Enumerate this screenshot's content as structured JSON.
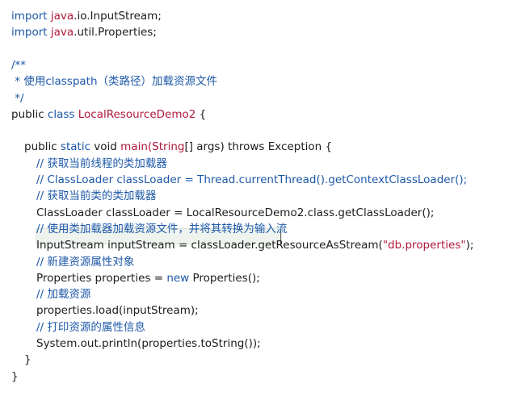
{
  "code": {
    "lines": [
      {
        "indent": 0,
        "segments": [
          {
            "t": "import ",
            "c": "blue"
          },
          {
            "t": "java",
            "c": "red"
          },
          {
            "t": ".io.InputStream;",
            "c": "dark"
          }
        ]
      },
      {
        "indent": 0,
        "segments": [
          {
            "t": "import ",
            "c": "blue"
          },
          {
            "t": "java",
            "c": "red"
          },
          {
            "t": ".util.Properties;",
            "c": "dark"
          }
        ]
      },
      {
        "indent": 0,
        "segments": [
          {
            "t": "",
            "c": "dark"
          }
        ]
      },
      {
        "indent": 0,
        "segments": [
          {
            "t": "/**",
            "c": "cm"
          }
        ]
      },
      {
        "indent": 0,
        "segments": [
          {
            "t": " * 使用classpath（类路径）加载资源文件",
            "c": "cm"
          }
        ]
      },
      {
        "indent": 0,
        "segments": [
          {
            "t": " */",
            "c": "cm"
          }
        ]
      },
      {
        "indent": 0,
        "segments": [
          {
            "t": "public ",
            "c": "dark"
          },
          {
            "t": "class ",
            "c": "blue"
          },
          {
            "t": "LocalResourceDemo2",
            "c": "red"
          },
          {
            "t": " {",
            "c": "dark"
          }
        ]
      },
      {
        "indent": 0,
        "segments": [
          {
            "t": "",
            "c": "dark"
          }
        ]
      },
      {
        "indent": 1,
        "segments": [
          {
            "t": "public ",
            "c": "dark"
          },
          {
            "t": "static ",
            "c": "blue"
          },
          {
            "t": "void ",
            "c": "dark"
          },
          {
            "t": "main",
            "c": "red"
          },
          {
            "t": "(String",
            "c": "red"
          },
          {
            "t": "[] args) throws Exception {",
            "c": "dark"
          }
        ]
      },
      {
        "indent": 2,
        "segments": [
          {
            "t": "// 获取当前线程的类加载器",
            "c": "cm"
          }
        ]
      },
      {
        "indent": 2,
        "segments": [
          {
            "t": "// ClassLoader classLoader = Thread.currentThread().getContextClassLoader();",
            "c": "cm"
          }
        ]
      },
      {
        "indent": 2,
        "segments": [
          {
            "t": "// 获取当前类的类加载器",
            "c": "cm"
          }
        ]
      },
      {
        "indent": 2,
        "segments": [
          {
            "t": "ClassLoader classLoader = LocalResourceDemo2.class.getClassLoader();",
            "c": "dark"
          }
        ]
      },
      {
        "indent": 2,
        "segments": [
          {
            "t": "// 使用类加载器加载资源文件，并将其转换为输入流",
            "c": "cm"
          }
        ]
      },
      {
        "indent": 2,
        "segments": [
          {
            "t": "InputStream inputStream = classLoader.getResourceAsStream(",
            "c": "dark"
          },
          {
            "t": "\"db.properties\"",
            "c": "red"
          },
          {
            "t": ");",
            "c": "dark"
          }
        ]
      },
      {
        "indent": 2,
        "segments": [
          {
            "t": "// 新建资源属性对象",
            "c": "cm"
          }
        ]
      },
      {
        "indent": 2,
        "segments": [
          {
            "t": "Properties properties = ",
            "c": "dark"
          },
          {
            "t": "new ",
            "c": "blue"
          },
          {
            "t": "Properties();",
            "c": "dark"
          }
        ]
      },
      {
        "indent": 2,
        "segments": [
          {
            "t": "// 加载资源",
            "c": "cm"
          }
        ]
      },
      {
        "indent": 2,
        "segments": [
          {
            "t": "properties.load(inputStream);",
            "c": "dark"
          }
        ]
      },
      {
        "indent": 2,
        "segments": [
          {
            "t": "// 打印资源的属性信息",
            "c": "cm"
          }
        ]
      },
      {
        "indent": 2,
        "segments": [
          {
            "t": "System.out.println(properties.toString());",
            "c": "dark"
          }
        ]
      },
      {
        "indent": 1,
        "segments": [
          {
            "t": "}",
            "c": "dark"
          }
        ]
      },
      {
        "indent": 0,
        "segments": [
          {
            "t": "}",
            "c": "dark"
          }
        ]
      }
    ],
    "highlighted_line_index": 13
  }
}
